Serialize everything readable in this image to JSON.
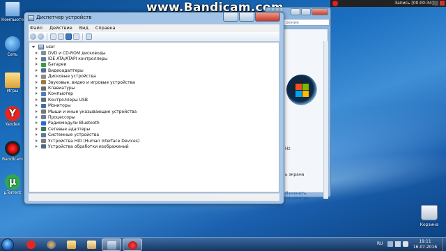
{
  "watermark": "www.Bandicam.com",
  "recorder": {
    "status": "Запись [00:00:34]"
  },
  "desktop_icons": [
    {
      "label": "Компьютер",
      "icon": "computer-icon"
    },
    {
      "label": "Сеть",
      "icon": "network-icon"
    },
    {
      "label": "Игры",
      "icon": "games-folder-icon"
    },
    {
      "label": "Yandex",
      "icon": "yandex-icon"
    },
    {
      "label": "Bandicam",
      "icon": "bandicam-icon"
    },
    {
      "label": "µTorrent",
      "icon": "utorrent-icon"
    }
  ],
  "recycle_bin": {
    "label": "Корзина",
    "icon": "recycle-bin-icon"
  },
  "background_window": {
    "search_placeholder": "оение",
    "text_hz": "Hz",
    "text_screen": "ь экрана",
    "link": "Изменить параметры"
  },
  "device_manager": {
    "title": "Диспетчер устройств",
    "menu": [
      "Файл",
      "Действие",
      "Вид",
      "Справка"
    ],
    "root": "user",
    "devices": [
      {
        "label": "DVD и CD-ROM дисководы",
        "color": "#8a8f96"
      },
      {
        "label": "IDE ATA/ATAPI контроллеры",
        "color": "#5b7da3"
      },
      {
        "label": "Батареи",
        "color": "#3a9b3a"
      },
      {
        "label": "Видеоадаптеры",
        "color": "#4e6f92"
      },
      {
        "label": "Дисковые устройства",
        "color": "#8c8c8c"
      },
      {
        "label": "Звуковые, видео и игровые устройства",
        "color": "#9a7b3d"
      },
      {
        "label": "Клавиатуры",
        "color": "#6c6c6c"
      },
      {
        "label": "Компьютер",
        "color": "#4f7fb6"
      },
      {
        "label": "Контроллеры USB",
        "color": "#5e6e80"
      },
      {
        "label": "Мониторы",
        "color": "#3f6fa8"
      },
      {
        "label": "Мыши и иные указывающие устройства",
        "color": "#777777"
      },
      {
        "label": "Процессоры",
        "color": "#6a7f95"
      },
      {
        "label": "Радиомодули Bluetooth",
        "color": "#2a6bd3"
      },
      {
        "label": "Сетевые адаптеры",
        "color": "#3d7a4f"
      },
      {
        "label": "Системные устройства",
        "color": "#5a7a9c"
      },
      {
        "label": "Устройства HID (Human Interface Devices)",
        "color": "#7c7c7c"
      },
      {
        "label": "Устройства обработки изображений",
        "color": "#4c6a8a"
      }
    ]
  },
  "taskbar": {
    "apps": [
      "yandex-browser",
      "windows-media-player",
      "file-explorer",
      "device-manager",
      "bandicam"
    ],
    "language": "RU",
    "time": "19:11",
    "date": "16.07.2016"
  }
}
